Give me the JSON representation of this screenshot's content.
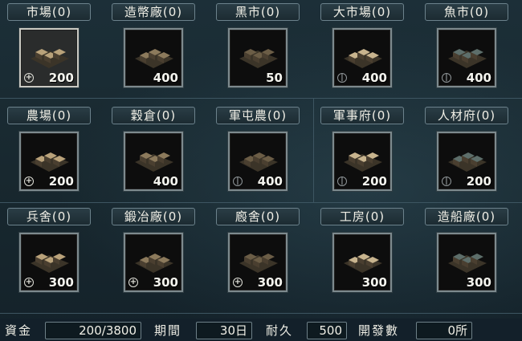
{
  "buildings": [
    {
      "label": "市場(0)",
      "cost": "200",
      "mark": "plus",
      "selected": true,
      "icon": "market-icon"
    },
    {
      "label": "造幣廠(0)",
      "cost": "400",
      "mark": "",
      "selected": false,
      "icon": "mint-icon"
    },
    {
      "label": "黑市(0)",
      "cost": "50",
      "mark": "",
      "selected": false,
      "icon": "black-market-icon"
    },
    {
      "label": "大市場(0)",
      "cost": "400",
      "mark": "one",
      "selected": false,
      "icon": "grand-market-icon"
    },
    {
      "label": "魚市(0)",
      "cost": "400",
      "mark": "one",
      "selected": false,
      "icon": "fish-market-icon"
    },
    {
      "label": "農場(0)",
      "cost": "200",
      "mark": "plus",
      "selected": false,
      "icon": "farm-icon"
    },
    {
      "label": "穀倉(0)",
      "cost": "400",
      "mark": "",
      "selected": false,
      "icon": "granary-icon"
    },
    {
      "label": "軍屯農(0)",
      "cost": "400",
      "mark": "one",
      "selected": false,
      "icon": "military-farm-icon"
    },
    {
      "label": "軍事府(0)",
      "cost": "200",
      "mark": "one",
      "selected": false,
      "icon": "military-office-icon"
    },
    {
      "label": "人材府(0)",
      "cost": "200",
      "mark": "one",
      "selected": false,
      "icon": "talent-office-icon"
    },
    {
      "label": "兵舍(0)",
      "cost": "300",
      "mark": "plus",
      "selected": false,
      "icon": "barracks-icon"
    },
    {
      "label": "鍛冶廠(0)",
      "cost": "300",
      "mark": "plus",
      "selected": false,
      "icon": "smithy-icon"
    },
    {
      "label": "廏舍(0)",
      "cost": "300",
      "mark": "plus",
      "selected": false,
      "icon": "stable-icon"
    },
    {
      "label": "工房(0)",
      "cost": "300",
      "mark": "",
      "selected": false,
      "icon": "workshop-icon"
    },
    {
      "label": "造船廠(0)",
      "cost": "300",
      "mark": "",
      "selected": false,
      "icon": "shipyard-icon"
    }
  ],
  "status": {
    "funds_label": "資金",
    "funds_value": "200/3800",
    "period_label": "期間",
    "period_value": "30日",
    "durability_label": "耐久",
    "durability_value": "500",
    "dev_count_label": "開發數",
    "dev_count_value": "0所"
  },
  "colors": {
    "background": "#18282f",
    "frame_border": "#7d8a8e",
    "label_border": "#6c828c"
  }
}
